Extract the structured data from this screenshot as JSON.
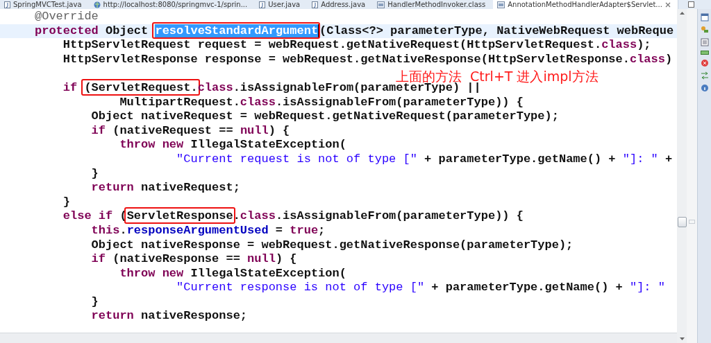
{
  "tabs": [
    {
      "label": "SpringMVCTest.java",
      "kind": "java",
      "selected": false
    },
    {
      "label": "http://localhost:8080/springmvc-1/sprin...",
      "kind": "web",
      "selected": false
    },
    {
      "label": "User.java",
      "kind": "java",
      "selected": false
    },
    {
      "label": "Address.java",
      "kind": "java",
      "selected": false
    },
    {
      "label": "HandlerMethodInvoker.class",
      "kind": "class",
      "selected": false
    },
    {
      "label": "AnnotationMethodHandlerAdapter$Servlet...",
      "kind": "class",
      "selected": true
    }
  ],
  "editor": {
    "lines": [
      {
        "current": false,
        "tokens": [
          {
            "kind": "annotation",
            "text": "@Override"
          }
        ]
      },
      {
        "current": true,
        "tokens": [
          {
            "kind": "keyword",
            "text": "protected"
          },
          {
            "kind": "plain",
            "text": " Object "
          },
          {
            "kind": "plain",
            "text": "resolveStandardArgument",
            "selected": true,
            "boxed": true
          },
          {
            "kind": "plain",
            "text": "(Class<?> parameterType, NativeWebRequest webReque"
          }
        ]
      },
      {
        "current": false,
        "tokens": [
          {
            "kind": "plain",
            "text": "    HttpServletRequest request = webRequest.getNativeRequest(HttpServletRequest."
          },
          {
            "kind": "keyword",
            "text": "class"
          },
          {
            "kind": "plain",
            "text": ");"
          }
        ]
      },
      {
        "current": false,
        "tokens": [
          {
            "kind": "plain",
            "text": "    HttpServletResponse response = webRequest.getNativeResponse(HttpServletResponse."
          },
          {
            "kind": "keyword",
            "text": "class"
          },
          {
            "kind": "plain",
            "text": ")"
          }
        ]
      },
      {
        "current": false
      },
      {
        "current": false,
        "tokens": [
          {
            "kind": "keyword",
            "text": "    if "
          },
          {
            "kind": "plain",
            "text": "(ServletRequest.",
            "boxed": true
          },
          {
            "kind": "keyword",
            "text": "class"
          },
          {
            "kind": "plain",
            "text": ".isAssignableFrom(parameterType) ||"
          }
        ]
      },
      {
        "current": false,
        "tokens": [
          {
            "kind": "plain",
            "text": "            MultipartRequest."
          },
          {
            "kind": "keyword",
            "text": "class"
          },
          {
            "kind": "plain",
            "text": ".isAssignableFrom(parameterType)) {"
          }
        ]
      },
      {
        "current": false,
        "tokens": [
          {
            "kind": "plain",
            "text": "        Object nativeRequest = webRequest.getNativeRequest(parameterType);"
          }
        ]
      },
      {
        "current": false,
        "tokens": [
          {
            "kind": "keyword",
            "text": "        if"
          },
          {
            "kind": "plain",
            "text": " (nativeRequest == "
          },
          {
            "kind": "keyword",
            "text": "null"
          },
          {
            "kind": "plain",
            "text": ") {"
          }
        ]
      },
      {
        "current": false,
        "tokens": [
          {
            "kind": "keyword",
            "text": "            throw new"
          },
          {
            "kind": "plain",
            "text": " IllegalStateException("
          }
        ]
      },
      {
        "current": false,
        "tokens": [
          {
            "kind": "string",
            "text": "                    \"Current request is not of type [\""
          },
          {
            "kind": "plain",
            "text": " + parameterType.getName() + "
          },
          {
            "kind": "string",
            "text": "\"]: \""
          },
          {
            "kind": "plain",
            "text": " +"
          }
        ]
      },
      {
        "current": false,
        "tokens": [
          {
            "kind": "plain",
            "text": "        }"
          }
        ]
      },
      {
        "current": false,
        "tokens": [
          {
            "kind": "keyword",
            "text": "        return"
          },
          {
            "kind": "plain",
            "text": " nativeRequest;"
          }
        ]
      },
      {
        "current": false,
        "tokens": [
          {
            "kind": "plain",
            "text": "    }"
          }
        ]
      },
      {
        "current": false,
        "tokens": [
          {
            "kind": "keyword",
            "text": "    else if"
          },
          {
            "kind": "plain",
            "text": " ("
          },
          {
            "kind": "plain",
            "text": "ServletResponse",
            "boxed": true
          },
          {
            "kind": "plain",
            "text": "."
          },
          {
            "kind": "keyword",
            "text": "class"
          },
          {
            "kind": "plain",
            "text": ".isAssignableFrom(parameterType)) {"
          }
        ]
      },
      {
        "current": false,
        "tokens": [
          {
            "kind": "keyword",
            "text": "        this"
          },
          {
            "kind": "plain",
            "text": "."
          },
          {
            "kind": "field",
            "text": "responseArgumentUsed"
          },
          {
            "kind": "plain",
            "text": " = "
          },
          {
            "kind": "keyword",
            "text": "true"
          },
          {
            "kind": "plain",
            "text": ";"
          }
        ]
      },
      {
        "current": false,
        "tokens": [
          {
            "kind": "plain",
            "text": "        Object nativeResponse = webRequest.getNativeResponse(parameterType);"
          }
        ]
      },
      {
        "current": false,
        "tokens": [
          {
            "kind": "keyword",
            "text": "        if"
          },
          {
            "kind": "plain",
            "text": " (nativeResponse == "
          },
          {
            "kind": "keyword",
            "text": "null"
          },
          {
            "kind": "plain",
            "text": ") {"
          }
        ]
      },
      {
        "current": false,
        "tokens": [
          {
            "kind": "keyword",
            "text": "            throw new"
          },
          {
            "kind": "plain",
            "text": " IllegalStateException("
          }
        ]
      },
      {
        "current": false,
        "tokens": [
          {
            "kind": "string",
            "text": "                    \"Current response is not of type [\""
          },
          {
            "kind": "plain",
            "text": " + parameterType.getName() + "
          },
          {
            "kind": "string",
            "text": "\"]: \""
          }
        ]
      },
      {
        "current": false,
        "tokens": [
          {
            "kind": "plain",
            "text": "        }"
          }
        ]
      },
      {
        "current": false,
        "tokens": [
          {
            "kind": "keyword",
            "text": "        return"
          },
          {
            "kind": "plain",
            "text": " nativeResponse;"
          }
        ]
      }
    ],
    "note": "上面的方法  Ctrl+T 进入impl方法"
  }
}
